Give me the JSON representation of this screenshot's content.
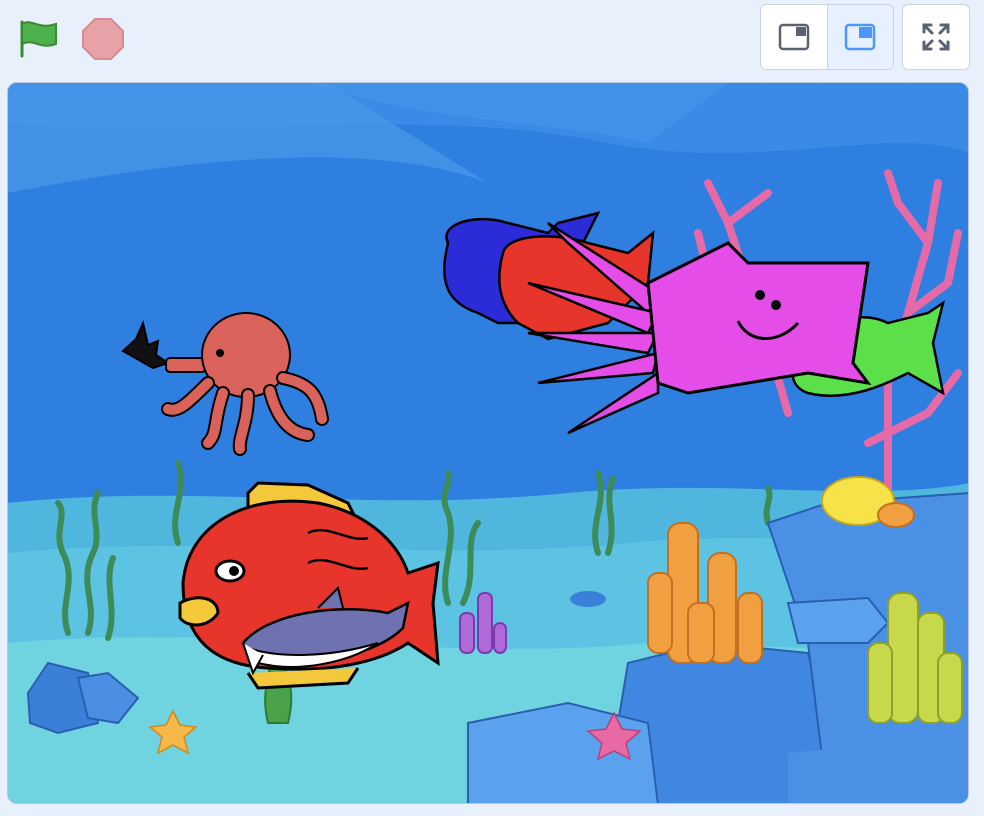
{
  "controls": {
    "green_flag": {
      "icon": "green-flag-icon",
      "color": "#4caf50"
    },
    "stop": {
      "icon": "stop-sign-icon",
      "color": "#e6a2a6"
    }
  },
  "stage_modes": {
    "small_stage": {
      "icon": "small-stage-icon",
      "active": false
    },
    "normal_stage": {
      "icon": "normal-stage-icon",
      "active": true
    },
    "fullscreen": {
      "icon": "fullscreen-icon"
    }
  },
  "stage": {
    "backdrop": "underwater",
    "sprites": [
      "octopus",
      "red-fish",
      "shark",
      "blue-blob",
      "red-blob",
      "pink-squid",
      "green-fish"
    ]
  },
  "colors": {
    "accent": "#4c97ff",
    "page_bg": "#e8f0fb",
    "water": "#2f7fe0",
    "sea_floor": "#6fd3e0"
  }
}
